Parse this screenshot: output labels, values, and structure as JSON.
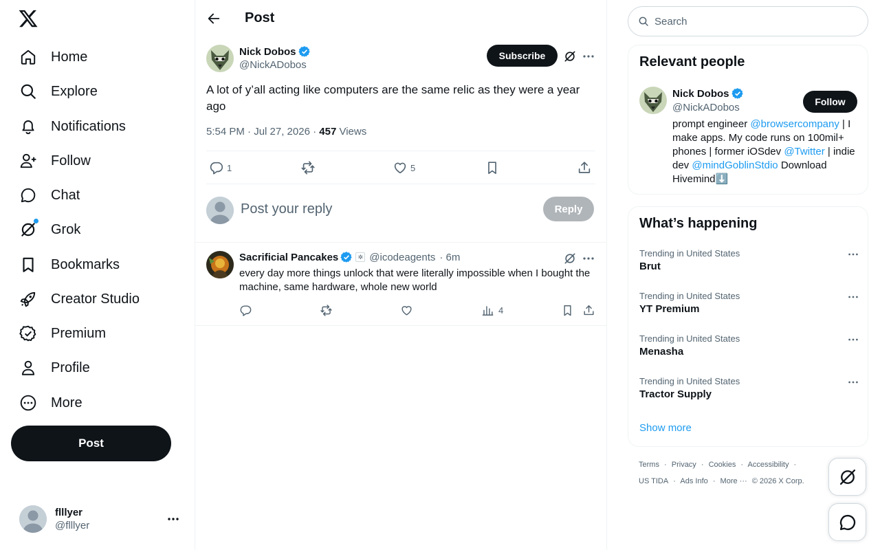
{
  "nav": {
    "items": [
      {
        "label": "Home",
        "icon": "home-icon"
      },
      {
        "label": "Explore",
        "icon": "search-icon"
      },
      {
        "label": "Notifications",
        "icon": "bell-icon"
      },
      {
        "label": "Follow",
        "icon": "person-add-icon"
      },
      {
        "label": "Chat",
        "icon": "chat-icon"
      },
      {
        "label": "Grok",
        "icon": "grok-icon"
      },
      {
        "label": "Bookmarks",
        "icon": "bookmark-icon"
      },
      {
        "label": "Creator Studio",
        "icon": "rocket-icon"
      },
      {
        "label": "Premium",
        "icon": "verified-check-icon"
      },
      {
        "label": "Profile",
        "icon": "person-icon"
      },
      {
        "label": "More",
        "icon": "more-circle-icon"
      }
    ],
    "post_button": "Post"
  },
  "account": {
    "name": "flllyer",
    "handle": "@flllyer"
  },
  "main": {
    "title": "Post",
    "tweet": {
      "author": "Nick Dobos",
      "handle": "@NickADobos",
      "subscribe_label": "Subscribe",
      "text": "A lot of y’all acting like computers are the same relic as they were a year ago",
      "time": "5:54 PM · Jul 27, 2026 · ",
      "views_count": "457",
      "views_label": " Views",
      "replies": "1",
      "likes": "5"
    },
    "reply_box": {
      "placeholder": "Post your reply",
      "button": "Reply"
    },
    "replies": [
      {
        "author": "Sacrificial Pancakes",
        "handle": "@icodeagents",
        "time": "· 6m",
        "text": "every day more things unlock that were literally impossible when I bought the machine, same hardware, whole new world",
        "views": "4"
      }
    ]
  },
  "sidebar": {
    "search_placeholder": "Search",
    "relevant_title": "Relevant people",
    "person": {
      "name": "Nick Dobos",
      "handle": "@NickADobos",
      "follow_label": "Follow",
      "bio_1": "prompt engineer ",
      "bio_link_1": "@browsercompany",
      "bio_2": " | I make apps. My code runs on 100mil+ phones | former iOSdev ",
      "bio_link_2": "@Twitter",
      "bio_3": " | indie dev ",
      "bio_link_3": "@mindGoblinStdio",
      "bio_4": " Download Hivemind⬇️"
    },
    "happening_title": "What’s happening",
    "trends": [
      {
        "category": "Trending in United States",
        "name": "Brut"
      },
      {
        "category": "Trending in United States",
        "name": "YT Premium"
      },
      {
        "category": "Trending in United States",
        "name": "Menasha"
      },
      {
        "category": "Trending in United States",
        "name": "Tractor Supply"
      }
    ],
    "show_more": "Show more",
    "footer_line1": [
      "Terms",
      "·",
      "Privacy",
      "·",
      "Cookies",
      "·",
      "Accessibility",
      "·"
    ],
    "footer_line2": [
      "US TIDA",
      "·",
      "Ads Info",
      "·",
      "More ···",
      "© 2026 X Corp."
    ]
  },
  "colors": {
    "accent": "#1d9bf0",
    "text": "#0f1419",
    "muted": "#536471",
    "border": "#eff3f4"
  }
}
